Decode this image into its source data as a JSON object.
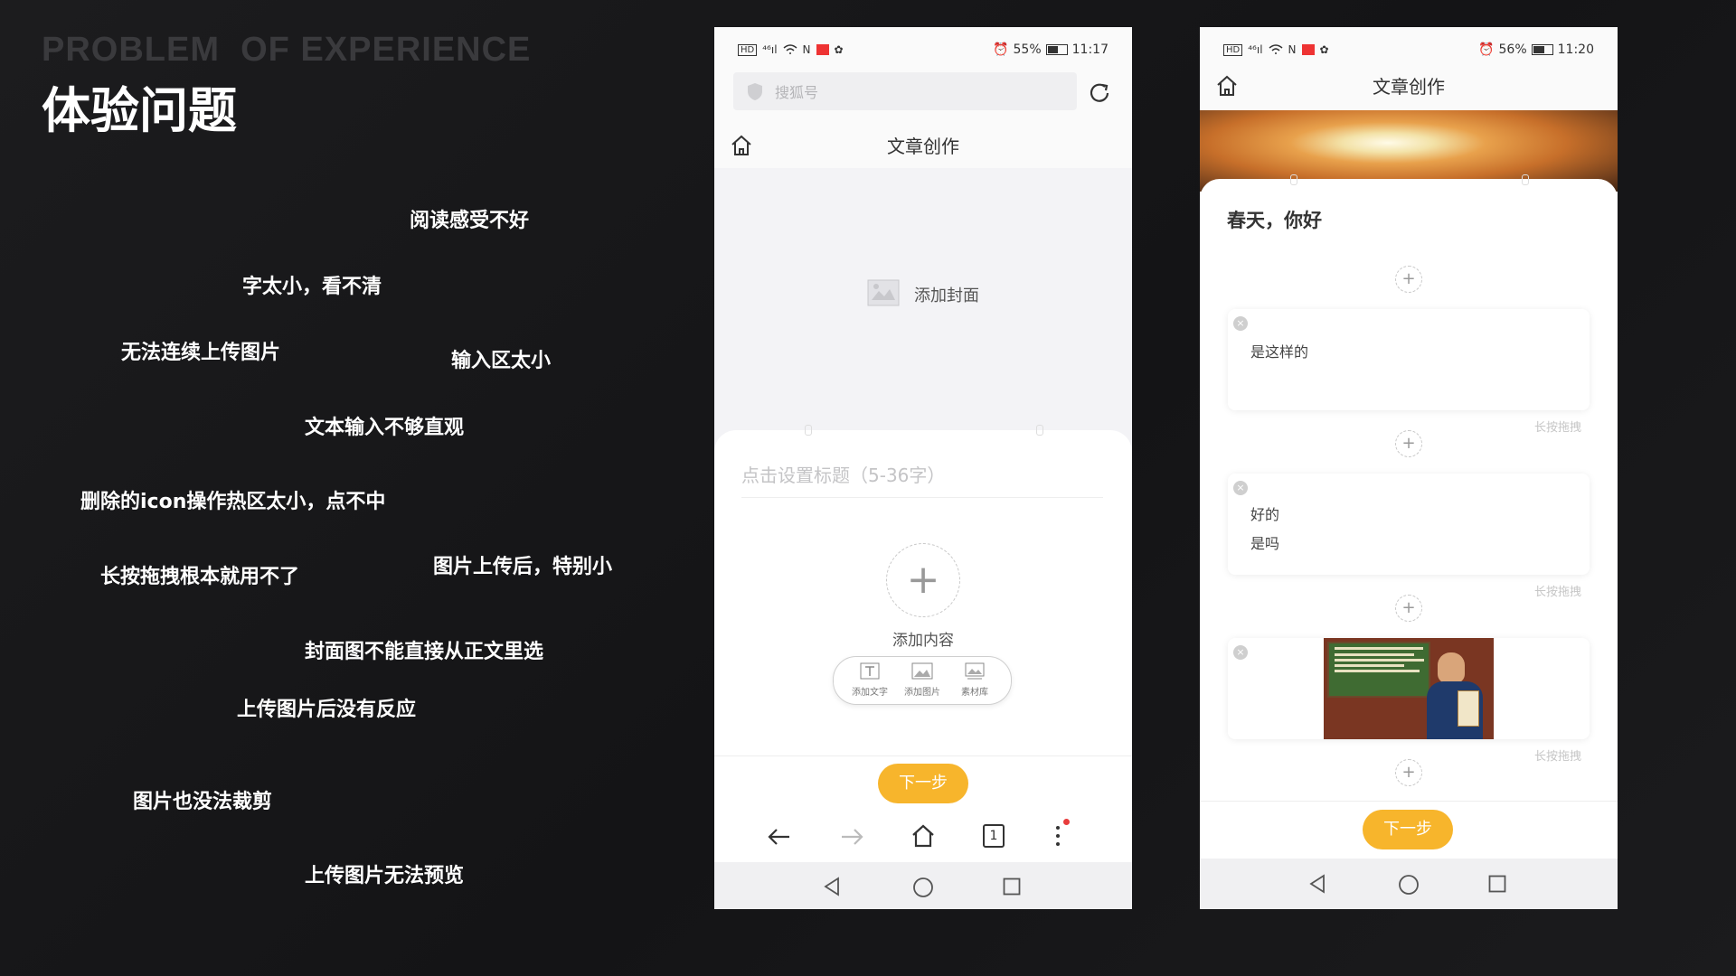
{
  "slide": {
    "subtitle_en": "PROBLEM  OF EXPERIENCE",
    "title_cn": "体验问题"
  },
  "problems": [
    "阅读感受不好",
    "字太小，看不清",
    "无法连续上传图片",
    "输入区太小",
    "文本输入不够直观",
    "删除的icon操作热区太小，点不中",
    "长按拖拽根本就用不了",
    "图片上传后，特别小",
    "封面图不能直接从正文里选",
    "上传图片后没有反应",
    "图片也没法裁剪",
    "上传图片无法预览"
  ],
  "phone1": {
    "status": {
      "battery": "55%",
      "time": "11:17"
    },
    "search_placeholder": "搜狐号",
    "header_title": "文章创作",
    "add_cover": "添加封面",
    "title_placeholder": "点击设置标题（5-36字）",
    "add_content": "添加内容",
    "tools": [
      "添加文字",
      "添加图片",
      "素材库"
    ],
    "next": "下一步",
    "tab_count": "1"
  },
  "phone2": {
    "status": {
      "battery": "56%",
      "time": "11:20"
    },
    "header_title": "文章创作",
    "article_title": "春天，你好",
    "card1_text": "是这样的",
    "card2_lines": [
      "好的",
      "是吗"
    ],
    "drag_label": "长按拖拽",
    "next": "下一步"
  },
  "colors": {
    "accent": "#f7b52c",
    "background": "#1a1a1c"
  }
}
